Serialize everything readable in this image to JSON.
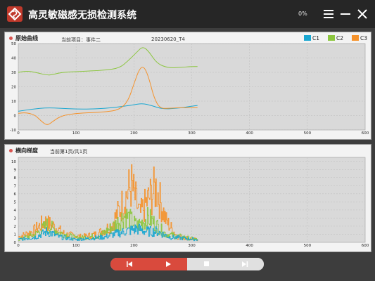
{
  "app": {
    "title": "高灵敏磁感无损检测系统",
    "progress": "0%"
  },
  "panel1": {
    "title": "原始曲线",
    "project": "当前项目：事件二",
    "file": "20230620_T4",
    "legend": [
      {
        "name": "C1",
        "color": "#1aa7d1"
      },
      {
        "name": "C2",
        "color": "#8cc63f"
      },
      {
        "name": "C3",
        "color": "#f5922b"
      }
    ]
  },
  "panel2": {
    "title": "横向梯度",
    "page": "当前第1页/共1页"
  },
  "colors": {
    "c1": "#1aa7d1",
    "c2": "#8cc63f",
    "c3": "#f5922b",
    "accent": "#d94a3d"
  },
  "icons": [
    "logo-icon",
    "menu-icon",
    "minimize-icon",
    "close-icon",
    "first-icon",
    "play-icon",
    "stop-icon",
    "last-icon"
  ],
  "chart_data": [
    {
      "type": "line",
      "title": "原始曲线",
      "xlim": [
        0,
        600
      ],
      "ylim": [
        -10,
        50
      ],
      "x_ticks": [
        0,
        100,
        200,
        300,
        400,
        500,
        600
      ],
      "y_ticks": [
        -10,
        0,
        10,
        20,
        30,
        40,
        50
      ],
      "grid": true,
      "legend_position": "top-right",
      "series": [
        {
          "name": "C1",
          "x": [
            0,
            25,
            50,
            75,
            100,
            125,
            150,
            175,
            200,
            215,
            230,
            250,
            275,
            300,
            310
          ],
          "y": [
            3,
            4.5,
            5.5,
            5,
            4.5,
            4.5,
            5,
            6,
            7.5,
            8.5,
            7,
            4.5,
            5,
            6.5,
            7
          ]
        },
        {
          "name": "C2",
          "x": [
            0,
            15,
            30,
            50,
            60,
            75,
            100,
            125,
            150,
            175,
            190,
            205,
            215,
            225,
            240,
            260,
            280,
            300,
            310
          ],
          "y": [
            30,
            31,
            30,
            28,
            28.5,
            30,
            30.5,
            31,
            31.5,
            33,
            38,
            44,
            48,
            45,
            36,
            33,
            33.5,
            34,
            34
          ]
        },
        {
          "name": "C3",
          "x": [
            0,
            10,
            20,
            30,
            40,
            50,
            60,
            75,
            100,
            125,
            150,
            175,
            190,
            200,
            210,
            218,
            226,
            235,
            245,
            260,
            280,
            300,
            310
          ],
          "y": [
            1.5,
            2,
            1.5,
            0,
            -4,
            -7,
            -4,
            0,
            1.5,
            2,
            2.5,
            4,
            10,
            22,
            33,
            34,
            26,
            12,
            5,
            5,
            5.5,
            5.5,
            5.5
          ]
        }
      ]
    },
    {
      "type": "line",
      "title": "横向梯度",
      "xlim": [
        0,
        600
      ],
      "ylim": [
        0,
        10.5
      ],
      "x_ticks": [
        0,
        100,
        200,
        300,
        400,
        500,
        600
      ],
      "y_ticks": [
        0,
        1,
        2,
        3,
        4,
        5,
        6,
        7,
        8,
        9,
        10
      ],
      "grid": true,
      "series": [
        {
          "name": "C1",
          "envelope": [
            [
              0,
              0.5
            ],
            [
              30,
              1
            ],
            [
              50,
              2
            ],
            [
              70,
              1
            ],
            [
              100,
              0.5
            ],
            [
              150,
              1
            ],
            [
              165,
              1.5
            ],
            [
              185,
              2
            ],
            [
              205,
              2.5
            ],
            [
              220,
              2
            ],
            [
              240,
              2
            ],
            [
              260,
              1
            ],
            [
              310,
              0.5
            ]
          ]
        },
        {
          "name": "C2",
          "envelope": [
            [
              0,
              0.5
            ],
            [
              30,
              1.5
            ],
            [
              50,
              3.2
            ],
            [
              70,
              1.8
            ],
            [
              100,
              0.8
            ],
            [
              140,
              1.2
            ],
            [
              165,
              3
            ],
            [
              185,
              5
            ],
            [
              205,
              3
            ],
            [
              225,
              4.5
            ],
            [
              240,
              3
            ],
            [
              255,
              1.5
            ],
            [
              310,
              0.5
            ]
          ]
        },
        {
          "name": "C3",
          "envelope": [
            [
              0,
              1
            ],
            [
              25,
              2
            ],
            [
              45,
              3.8
            ],
            [
              60,
              3
            ],
            [
              80,
              1.5
            ],
            [
              110,
              1
            ],
            [
              135,
              1.5
            ],
            [
              160,
              3
            ],
            [
              175,
              6
            ],
            [
              195,
              10.5
            ],
            [
              210,
              5
            ],
            [
              225,
              8
            ],
            [
              238,
              10
            ],
            [
              255,
              4
            ],
            [
              275,
              1
            ],
            [
              310,
              0.5
            ]
          ]
        }
      ]
    }
  ]
}
